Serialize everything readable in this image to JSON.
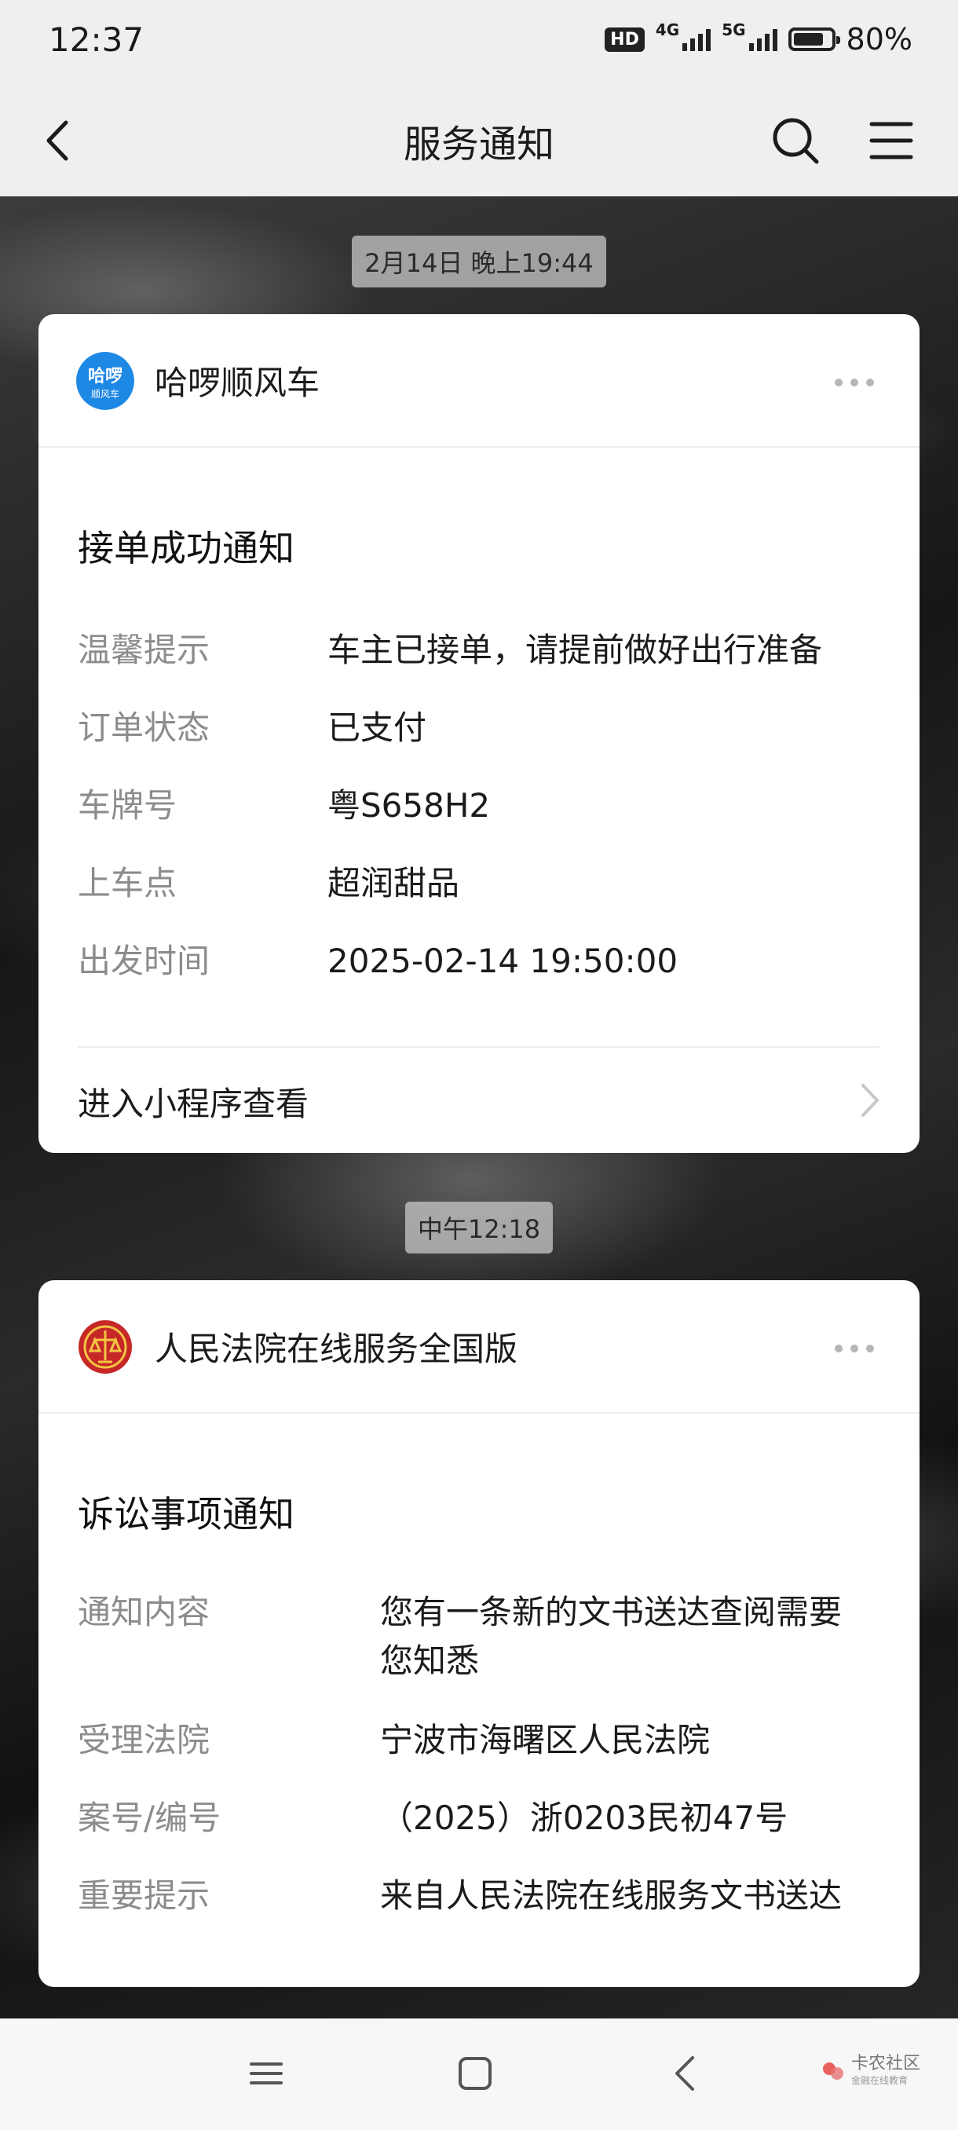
{
  "status": {
    "time": "12:37",
    "hd": "HD",
    "net1": "4G",
    "net2": "5G",
    "battery": "80%",
    "battery_level": 0.8
  },
  "nav": {
    "title": "服务通知"
  },
  "messages": [
    {
      "timestamp": "2月14日 晚上19:44",
      "app_name": "哈啰顺风车",
      "logo_text": "哈啰",
      "logo_sub": "顺风车",
      "title": "接单成功通知",
      "rows": [
        {
          "key": "温馨提示",
          "value": "车主已接单，请提前做好出行准备"
        },
        {
          "key": "订单状态",
          "value": "已支付"
        },
        {
          "key": "车牌号",
          "value": "粤S658H2"
        },
        {
          "key": "上车点",
          "value": "超润甜品"
        },
        {
          "key": "出发时间",
          "value": "2025-02-14 19:50:00"
        }
      ],
      "footer": "进入小程序查看"
    },
    {
      "timestamp": "中午12:18",
      "app_name": "人民法院在线服务全国版",
      "title": "诉讼事项通知",
      "rows": [
        {
          "key": "通知内容",
          "value": "您有一条新的文书送达查阅需要",
          "value2": "您知悉"
        },
        {
          "key": "受理法院",
          "value": "宁波市海曙区人民法院"
        },
        {
          "key": "案号/编号",
          "value": "（2025）浙0203民初47号"
        },
        {
          "key": "重要提示",
          "value": "来自人民法院在线服务文书送达"
        }
      ]
    }
  ],
  "watermark": {
    "text": "卡农社区",
    "sub": "金融在线教育"
  },
  "colors": {
    "background": "#efefef",
    "card": "#ffffff",
    "muted": "#8c8c8c",
    "hello_blue": "#1e88e5",
    "court_red": "#c62828"
  }
}
